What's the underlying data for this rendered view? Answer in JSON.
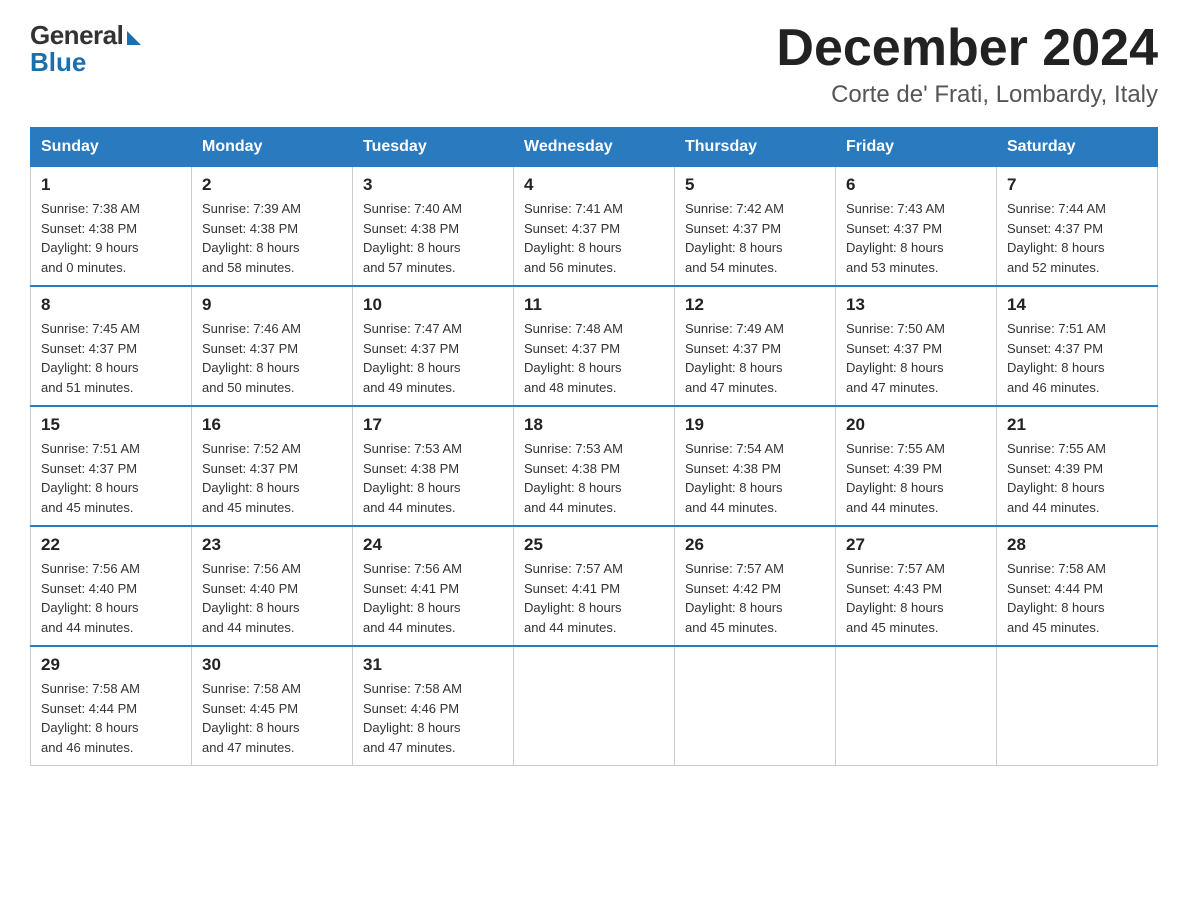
{
  "logo": {
    "general": "General",
    "blue": "Blue"
  },
  "title": "December 2024",
  "subtitle": "Corte de' Frati, Lombardy, Italy",
  "weekdays": [
    "Sunday",
    "Monday",
    "Tuesday",
    "Wednesday",
    "Thursday",
    "Friday",
    "Saturday"
  ],
  "weeks": [
    [
      {
        "day": "1",
        "sunrise": "7:38 AM",
        "sunset": "4:38 PM",
        "daylight": "9 hours and 0 minutes."
      },
      {
        "day": "2",
        "sunrise": "7:39 AM",
        "sunset": "4:38 PM",
        "daylight": "8 hours and 58 minutes."
      },
      {
        "day": "3",
        "sunrise": "7:40 AM",
        "sunset": "4:38 PM",
        "daylight": "8 hours and 57 minutes."
      },
      {
        "day": "4",
        "sunrise": "7:41 AM",
        "sunset": "4:37 PM",
        "daylight": "8 hours and 56 minutes."
      },
      {
        "day": "5",
        "sunrise": "7:42 AM",
        "sunset": "4:37 PM",
        "daylight": "8 hours and 54 minutes."
      },
      {
        "day": "6",
        "sunrise": "7:43 AM",
        "sunset": "4:37 PM",
        "daylight": "8 hours and 53 minutes."
      },
      {
        "day": "7",
        "sunrise": "7:44 AM",
        "sunset": "4:37 PM",
        "daylight": "8 hours and 52 minutes."
      }
    ],
    [
      {
        "day": "8",
        "sunrise": "7:45 AM",
        "sunset": "4:37 PM",
        "daylight": "8 hours and 51 minutes."
      },
      {
        "day": "9",
        "sunrise": "7:46 AM",
        "sunset": "4:37 PM",
        "daylight": "8 hours and 50 minutes."
      },
      {
        "day": "10",
        "sunrise": "7:47 AM",
        "sunset": "4:37 PM",
        "daylight": "8 hours and 49 minutes."
      },
      {
        "day": "11",
        "sunrise": "7:48 AM",
        "sunset": "4:37 PM",
        "daylight": "8 hours and 48 minutes."
      },
      {
        "day": "12",
        "sunrise": "7:49 AM",
        "sunset": "4:37 PM",
        "daylight": "8 hours and 47 minutes."
      },
      {
        "day": "13",
        "sunrise": "7:50 AM",
        "sunset": "4:37 PM",
        "daylight": "8 hours and 47 minutes."
      },
      {
        "day": "14",
        "sunrise": "7:51 AM",
        "sunset": "4:37 PM",
        "daylight": "8 hours and 46 minutes."
      }
    ],
    [
      {
        "day": "15",
        "sunrise": "7:51 AM",
        "sunset": "4:37 PM",
        "daylight": "8 hours and 45 minutes."
      },
      {
        "day": "16",
        "sunrise": "7:52 AM",
        "sunset": "4:37 PM",
        "daylight": "8 hours and 45 minutes."
      },
      {
        "day": "17",
        "sunrise": "7:53 AM",
        "sunset": "4:38 PM",
        "daylight": "8 hours and 44 minutes."
      },
      {
        "day": "18",
        "sunrise": "7:53 AM",
        "sunset": "4:38 PM",
        "daylight": "8 hours and 44 minutes."
      },
      {
        "day": "19",
        "sunrise": "7:54 AM",
        "sunset": "4:38 PM",
        "daylight": "8 hours and 44 minutes."
      },
      {
        "day": "20",
        "sunrise": "7:55 AM",
        "sunset": "4:39 PM",
        "daylight": "8 hours and 44 minutes."
      },
      {
        "day": "21",
        "sunrise": "7:55 AM",
        "sunset": "4:39 PM",
        "daylight": "8 hours and 44 minutes."
      }
    ],
    [
      {
        "day": "22",
        "sunrise": "7:56 AM",
        "sunset": "4:40 PM",
        "daylight": "8 hours and 44 minutes."
      },
      {
        "day": "23",
        "sunrise": "7:56 AM",
        "sunset": "4:40 PM",
        "daylight": "8 hours and 44 minutes."
      },
      {
        "day": "24",
        "sunrise": "7:56 AM",
        "sunset": "4:41 PM",
        "daylight": "8 hours and 44 minutes."
      },
      {
        "day": "25",
        "sunrise": "7:57 AM",
        "sunset": "4:41 PM",
        "daylight": "8 hours and 44 minutes."
      },
      {
        "day": "26",
        "sunrise": "7:57 AM",
        "sunset": "4:42 PM",
        "daylight": "8 hours and 45 minutes."
      },
      {
        "day": "27",
        "sunrise": "7:57 AM",
        "sunset": "4:43 PM",
        "daylight": "8 hours and 45 minutes."
      },
      {
        "day": "28",
        "sunrise": "7:58 AM",
        "sunset": "4:44 PM",
        "daylight": "8 hours and 45 minutes."
      }
    ],
    [
      {
        "day": "29",
        "sunrise": "7:58 AM",
        "sunset": "4:44 PM",
        "daylight": "8 hours and 46 minutes."
      },
      {
        "day": "30",
        "sunrise": "7:58 AM",
        "sunset": "4:45 PM",
        "daylight": "8 hours and 47 minutes."
      },
      {
        "day": "31",
        "sunrise": "7:58 AM",
        "sunset": "4:46 PM",
        "daylight": "8 hours and 47 minutes."
      },
      null,
      null,
      null,
      null
    ]
  ]
}
